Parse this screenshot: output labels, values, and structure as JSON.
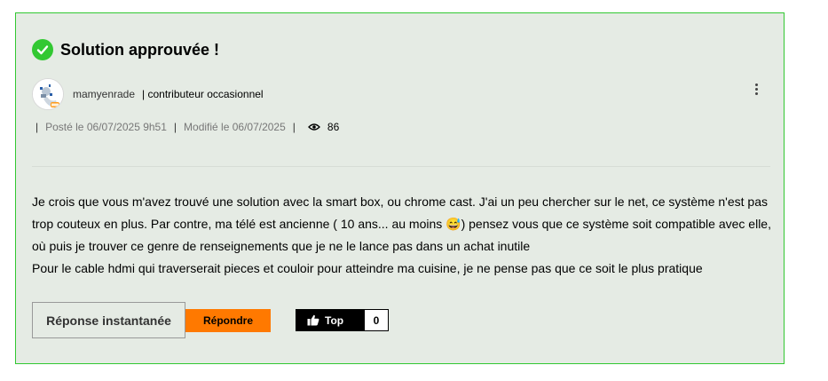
{
  "post": {
    "title": "Solution approuvée !",
    "author": "mamyenrade",
    "rank_sep": "|",
    "rank": "contributeur occasionnel",
    "posted": "Posté le 06/07/2025 9h51",
    "modified": "Modifié le 06/07/2025",
    "views": "86",
    "body": [
      "Je crois que vous m'avez trouvé une solution avec la smart box, ou chrome cast. J'ai un peu chercher sur le net, ce système n'est pas trop couteux en plus. Par contre, ma télé est ancienne ( 10 ans... au moins 😅) pensez vous que ce système soit compatible avec elle, où puis je trouver ce genre de renseignements que je ne le lance pas dans un achat inutile",
      "Pour le cable hdmi qui traverserait pieces et couloir pour atteindre ma cuisine, je ne pense pas que ce soit le plus pratique"
    ]
  },
  "actions": {
    "instant_reply": "Réponse instantanée",
    "reply": "Répondre",
    "kudo_label": "Top",
    "kudo_count": "0"
  },
  "colors": {
    "accent_green": "#32c832",
    "reply_orange": "#ff7900",
    "card_bg": "#e5ebe4"
  }
}
